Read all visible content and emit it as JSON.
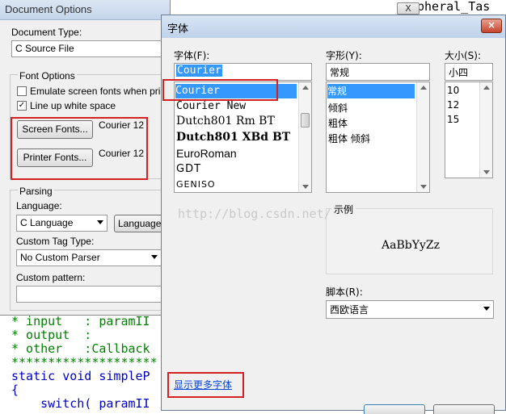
{
  "code": {
    "behind_title": "pheral_Tas",
    "lines": [
      "* input   : paramII",
      "* output  :",
      "* other   :Callback",
      "********************",
      "static void simpleP",
      "{",
      "    switch( paramII"
    ]
  },
  "doc_options": {
    "title": "Document Options",
    "close_label": "X",
    "document_type_label": "Document Type:",
    "document_type_value": "C Source File",
    "font_options_label": "Font Options",
    "emulate_label": "Emulate screen fonts when printing",
    "emulate_checked": false,
    "lineup_label": "Line up white space",
    "lineup_checked": true,
    "screen_fonts_button": "Screen Fonts...",
    "screen_font_value": "Courier 12",
    "printer_fonts_button": "Printer Fonts...",
    "printer_font_value": "Courier 12",
    "parsing_label": "Parsing",
    "language_label": "Language:",
    "language_value": "C Language",
    "language_button": "Language...",
    "custom_tag_label": "Custom Tag Type:",
    "custom_tag_value": "No Custom Parser",
    "custom_pattern_label": "Custom pattern:",
    "custom_pattern_value": ""
  },
  "font_dialog": {
    "title": "字体",
    "close_label": "×",
    "font_label": "字体(F):",
    "font_input": "Courier",
    "font_list": [
      "Courier",
      "Courier New",
      "Dutch801 Rm BT",
      "Dutch801 XBd BT",
      "EuroRoman",
      "GDT",
      "GENISO"
    ],
    "style_label": "字形(Y):",
    "style_input": "常规",
    "style_list": [
      "常规",
      "倾斜",
      "粗体",
      "粗体 倾斜"
    ],
    "size_label": "大小(S):",
    "size_input": "小四",
    "size_list": [
      "10",
      "12",
      "15"
    ],
    "sample_label": "示例",
    "sample_text": "AaBbYyZz",
    "script_label": "脚本(R):",
    "script_value": "西欧语言",
    "show_more_link": "显示更多字体",
    "watermark": "http://blog.csdn.net/"
  },
  "colors": {
    "selection": "#3399ff",
    "highlight_red": "#d42020",
    "code_comment": "#008000",
    "code_keyword": "#0000c0"
  }
}
